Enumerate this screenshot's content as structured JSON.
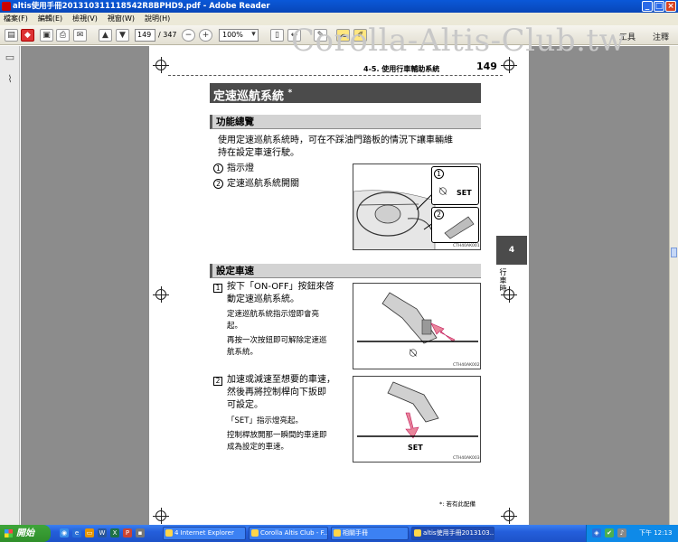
{
  "window": {
    "title": "altis使用手冊201310311118542R8BPHD9.pdf - Adobe Reader",
    "controls": {
      "minimize": "_",
      "maximize": "□",
      "close": "×"
    }
  },
  "menu": [
    "檔案(F)",
    "編輯(E)",
    "檢視(V)",
    "視窗(W)",
    "說明(H)"
  ],
  "toolbar": {
    "page_current": "149",
    "page_total": "/ 347",
    "zoom": "100%",
    "tools_label": "工具",
    "comment_label": "注釋",
    "icons": [
      "open-icon",
      "create-pdf-icon",
      "save-icon",
      "print-icon",
      "email-icon",
      "prev-page-icon",
      "next-page-icon",
      "zoom-out-icon",
      "zoom-in-icon",
      "fit-page-icon",
      "fit-width-icon",
      "sign-icon",
      "comment-icon",
      "highlight-icon"
    ]
  },
  "watermark": "Corolla-Altis-Club.tw",
  "page": {
    "section_header": "4-5. 使用行車輔助系統",
    "page_number": "149",
    "title": "定速巡航系統",
    "title_mark": "*",
    "overview_heading": "功能總覽",
    "overview_text_1": "使用定速巡航系統時，可在不踩油門踏板的情況下讓車輛維",
    "overview_text_2": "持在設定車速行駛。",
    "item1_num": "1",
    "item1_label": "指示燈",
    "item2_num": "2",
    "item2_label": "定速巡航系統開關",
    "fig1_set": "SET",
    "fig1_code": "CTH40AK001",
    "fig1_callout1": "1",
    "fig1_callout2": "2",
    "set_heading": "設定車速",
    "step1_num": "1",
    "step1_line1": "按下「ON-OFF」按鈕來啓",
    "step1_line2": "動定速巡航系統。",
    "step1_note1_line1": "定速巡航系統指示燈即會亮",
    "step1_note1_line2": "起。",
    "step1_note2_line1": "再按一次按鈕即可解除定速巡",
    "step1_note2_line2": "航系統。",
    "fig2_code": "CTH40AK002",
    "step2_num": "2",
    "step2_line1": "加速或減速至想要的車速，",
    "step2_line2": "然後再將控制桿向下扳即",
    "step2_line3": "可設定。",
    "step2_note1": "「SET」指示燈亮起。",
    "step2_note2_line1": "控制桿放開那一瞬間的車速即",
    "step2_note2_line2": "成為設定的車速。",
    "fig3_set": "SET",
    "fig3_code": "CTH40AK003",
    "side_tab_num": "4",
    "side_tab_text": "行車時",
    "footnote": "*: 若有此配備"
  },
  "taskbar": {
    "start": "開始",
    "tasks": [
      "4 Internet Explorer",
      "Corolla Altis Club - F...",
      "相關手冊",
      "altis使用手冊2013103..."
    ],
    "clock": "下午 12:13"
  }
}
